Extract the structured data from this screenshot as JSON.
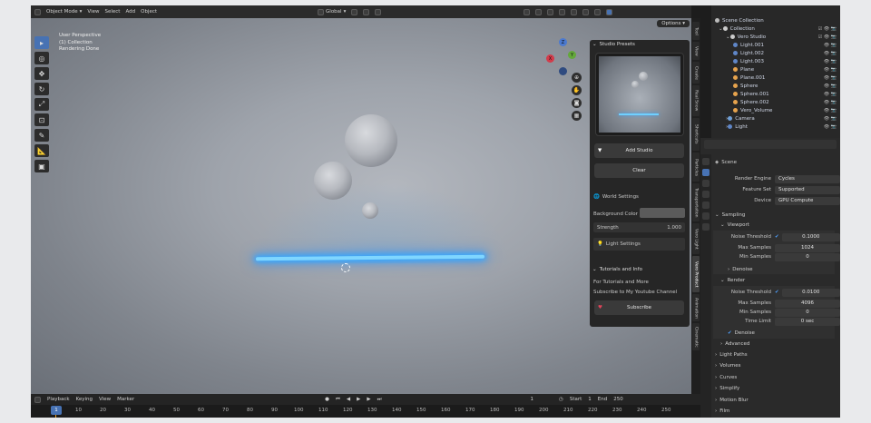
{
  "topbar": {
    "mode": "Object Mode",
    "menus": [
      "View",
      "Select",
      "Add",
      "Object"
    ],
    "transform_orientation": "Global"
  },
  "viewport": {
    "info_lines": [
      "User Perspective",
      "(1) Collection",
      "Rendering Done"
    ],
    "options_label": "Options",
    "gizmo_axes": {
      "x": "X",
      "y": "Y",
      "z": "Z"
    }
  },
  "side_tabs": [
    "Tool",
    "View",
    "Create",
    "Real Snow",
    "Shortcuts",
    "Particles",
    "Transportation",
    "Vero Light",
    "Vero Product",
    "Animation",
    "Cinematic"
  ],
  "npanel": {
    "studio_presets_title": "Studio Presets",
    "add_studio_label": "Add Studio",
    "clear_label": "Clear",
    "world_settings_label": "World Settings",
    "background_color_label": "Background Color",
    "strength_label": "Strength",
    "strength_value": "1.000",
    "light_settings_label": "Light Settings",
    "tutorials_title": "Tutorials and Info",
    "tutorials_text": "For Tutorials and More",
    "subscribe_text": "Subscribe to My Youtube Channel",
    "subscribe_label": "Subscribe"
  },
  "outliner": {
    "scene_collection": "Scene Collection",
    "collection": "Collection",
    "vero_studio": "Vero Studio",
    "items": [
      "Light.001",
      "Light.002",
      "Light.003",
      "Plane",
      "Plane.001",
      "Sphere",
      "Sphere.001",
      "Sphere.002",
      "Vero_Volume"
    ],
    "camera": "Camera",
    "light": "Light"
  },
  "properties": {
    "scene_label": "Scene",
    "render_engine_label": "Render Engine",
    "render_engine": "Cycles",
    "feature_set_label": "Feature Set",
    "feature_set": "Supported",
    "device_label": "Device",
    "device": "GPU Compute",
    "sampling": "Sampling",
    "viewport": "Viewport",
    "noise_threshold_label": "Noise Threshold",
    "vp_noise_threshold": "0.1000",
    "max_samples_label": "Max Samples",
    "vp_max_samples": "1024",
    "min_samples_label": "Min Samples",
    "vp_min_samples": "0",
    "denoise_label": "Denoise",
    "render": "Render",
    "r_noise_threshold": "0.0100",
    "r_max_samples": "4096",
    "r_min_samples": "0",
    "time_limit_label": "Time Limit",
    "time_limit": "0 sec",
    "advanced": "Advanced",
    "light_paths": "Light Paths",
    "volumes": "Volumes",
    "curves": "Curves",
    "simplify": "Simplify",
    "motion_blur": "Motion Blur",
    "film": "Film"
  },
  "timeline": {
    "menus": [
      "Playback",
      "Keying",
      "View",
      "Marker"
    ],
    "current_frame": "1",
    "start_label": "Start",
    "start": "1",
    "end_label": "End",
    "end": "250",
    "frame_ticks": [
      "10",
      "20",
      "30",
      "40",
      "50",
      "60",
      "70",
      "80",
      "90",
      "100",
      "110",
      "120",
      "130",
      "140",
      "150",
      "160",
      "170",
      "180",
      "190",
      "200",
      "210",
      "220",
      "230",
      "240",
      "250"
    ]
  },
  "colors": {
    "accent": "#4772b3",
    "light_bar": "#7fd6ff",
    "subscribe_heart": "#e0445a"
  }
}
